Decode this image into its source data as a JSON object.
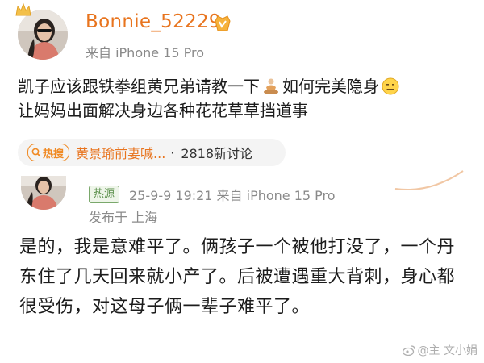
{
  "post": {
    "username": "Bonnie_52229",
    "meta": "来自 iPhone 15 Pro",
    "content_line1_a": "凯子应该跟铁拳组黄兄弟请教一下",
    "content_line1_b": "如何完美隐身",
    "content_line2": "让妈妈出面解决身边各种花花草草挡道事",
    "topic": {
      "hot_label": "热搜",
      "title": "黄景瑜前妻喊...",
      "dot": "·",
      "count": "2818新讨论"
    },
    "icons": [
      "crown-icon",
      "vip-badge-icon",
      "meditate-emoji-icon",
      "smile-emoji-icon",
      "hot-search-icon"
    ]
  },
  "reply": {
    "source_badge": "热源",
    "meta": "25-9-9 19:21 来自 iPhone 15 Pro",
    "location": "发布于 上海",
    "text": "是的，我是意难平了。俩孩子一个被他打没了，一个丹东住了几天回来就小产了。后被遭遇重大背刺，身心都很受伤，对这母子俩一辈子难平了。"
  },
  "watermark": "@主 文小娟",
  "colors": {
    "username": "#e8741e",
    "meta": "#8a8a8a",
    "topic_bg": "#f4f4f4",
    "hot": "#f08a24",
    "source_badge": "#5a8f4b"
  }
}
